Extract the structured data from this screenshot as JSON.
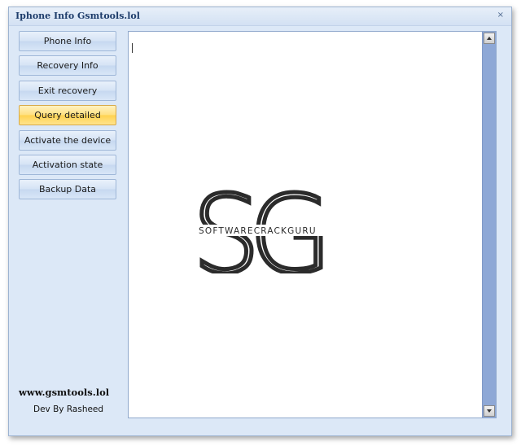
{
  "window": {
    "title": "Iphone Info Gsmtools.lol",
    "close_glyph": "×"
  },
  "sidebar": {
    "buttons": [
      {
        "label": "Phone Info",
        "active": false
      },
      {
        "label": "Recovery Info",
        "active": false
      },
      {
        "label": "Exit recovery",
        "active": false
      },
      {
        "label": "Query detailed",
        "active": true
      },
      {
        "label": "Activate the device",
        "active": false
      },
      {
        "label": "Activation state",
        "active": false
      },
      {
        "label": "Backup Data",
        "active": false
      }
    ]
  },
  "footer": {
    "site": "www.gsmtools.lol",
    "dev": "Dev By Rasheed"
  },
  "output": {
    "value": ""
  },
  "watermark": {
    "letters": "SG",
    "text": "SOFTWARECRACKGURU"
  },
  "colors": {
    "active_button": "#ffd24f",
    "window_bg": "#dce8f7",
    "scrollbar": "#8ea8d6",
    "title_text": "#1e3d6b"
  }
}
